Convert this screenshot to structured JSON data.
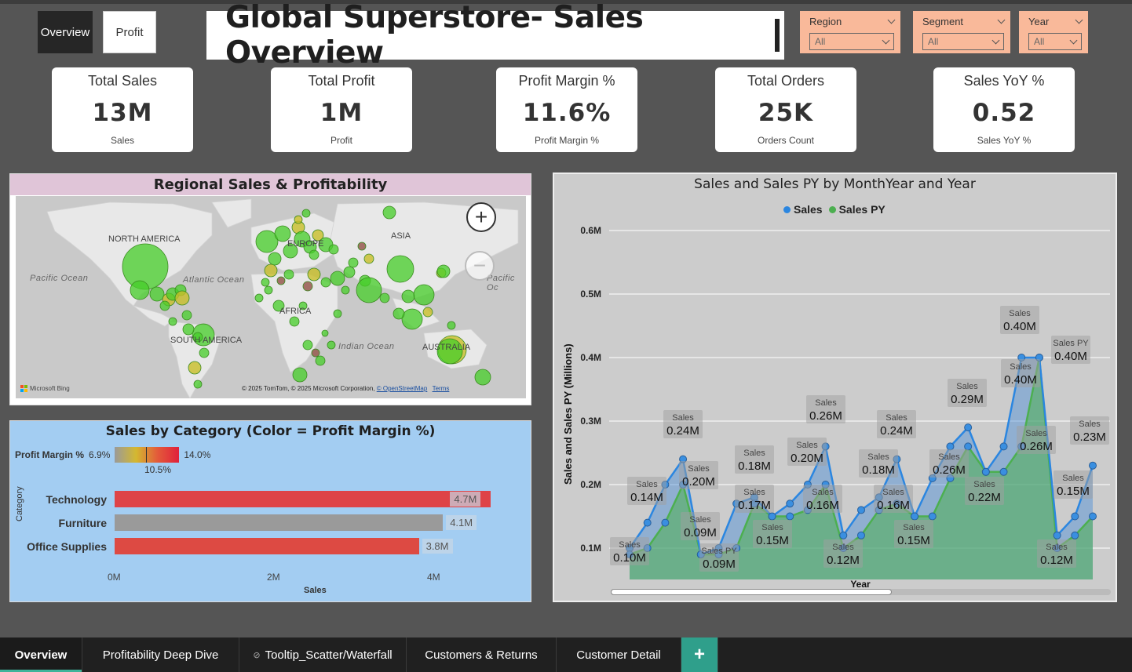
{
  "nav": {
    "overview_label": "Overview",
    "profit_label": "Profit"
  },
  "title": "Global Superstore- Sales Overview",
  "slicers": [
    {
      "label": "Region",
      "value": "All"
    },
    {
      "label": "Segment",
      "value": "All"
    },
    {
      "label": "Year",
      "value": "All"
    }
  ],
  "kpis": [
    {
      "title": "Total Sales",
      "value": "13M",
      "sub": "Sales"
    },
    {
      "title": "Total Profit",
      "value": "1M",
      "sub": "Profit"
    },
    {
      "title": "Profit Margin %",
      "value": "11.6%",
      "sub": "Profit Margin %"
    },
    {
      "title": "Total Orders",
      "value": "25K",
      "sub": "Orders Count"
    },
    {
      "title": "Sales YoY %",
      "value": "0.52",
      "sub": "Sales YoY %"
    }
  ],
  "map": {
    "title": "Regional Sales & Profitability",
    "labels": {
      "na": "NORTH AMERICA",
      "sa": "SOUTH AMERICA",
      "eu": "EUROPE",
      "asia": "ASIA",
      "africa": "AFRICA",
      "aus": "AUSTRALIA"
    },
    "oceans": {
      "pacific": "Pacific Ocean",
      "atlantic": "Atlantic Ocean",
      "indian": "Indian Ocean",
      "pacific2": "Pacific Oc"
    },
    "attribution": "© 2025 TomTom, © 2025 Microsoft Corporation,",
    "osm": "© OpenStreetMap",
    "terms": "Terms",
    "bing": "Microsoft Bing",
    "zoom_in": "+",
    "zoom_out": "−"
  },
  "category": {
    "title": "Sales by Category (Color = Profit Margin %)",
    "legend_label": "Profit Margin %",
    "legend_min": "6.9%",
    "legend_max": "14.0%",
    "legend_mid": "10.5%",
    "axis_title": "Category",
    "x_title": "Sales",
    "ticks": [
      "0M",
      "2M",
      "4M"
    ],
    "colors": {
      "technology": "#de4347",
      "furniture": "#9a9a9a",
      "office": "#dd4a43"
    }
  },
  "chart_data": [
    {
      "type": "bar",
      "title": "Sales by Category (Color = Profit Margin %)",
      "categories": [
        "Technology",
        "Furniture",
        "Office Supplies"
      ],
      "values": [
        4.7,
        4.1,
        3.8
      ],
      "value_labels": [
        "4.7M",
        "4.1M",
        "3.8M"
      ],
      "xlabel": "Sales",
      "ylabel": "Category",
      "xlim": [
        0,
        4.7
      ]
    },
    {
      "type": "area",
      "title": "Sales and Sales PY by MonthYear and Year",
      "xlabel": "Year",
      "ylabel": "Sales and Sales PY (Millions)",
      "ylim": [
        0.1,
        0.6
      ],
      "yticks": [
        "0.6M",
        "0.5M",
        "0.4M",
        "0.3M",
        "0.2M",
        "0.1M"
      ],
      "legend_position": "top",
      "series": [
        {
          "name": "Sales",
          "color": "#2b86e0",
          "values": [
            0.1,
            0.14,
            0.2,
            0.24,
            0.09,
            0.1,
            0.17,
            0.18,
            0.15,
            0.17,
            0.2,
            0.26,
            0.12,
            0.16,
            0.18,
            0.24,
            0.15,
            0.21,
            0.26,
            0.29,
            0.22,
            0.26,
            0.4,
            0.4,
            0.12,
            0.15,
            0.23
          ]
        },
        {
          "name": "Sales PY",
          "color": "#4caf50",
          "values": [
            0.09,
            0.1,
            0.14,
            0.2,
            0.09,
            0.09,
            0.1,
            0.17,
            0.15,
            0.15,
            0.16,
            0.2,
            0.1,
            0.12,
            0.16,
            0.17,
            0.15,
            0.15,
            0.21,
            0.26,
            0.22,
            0.22,
            0.26,
            0.4,
            0.1,
            0.12,
            0.15
          ]
        }
      ],
      "point_labels": [
        {
          "series": "Sales",
          "text": "0.10M"
        },
        {
          "series": "Sales",
          "text": "0.14M"
        },
        {
          "series": "Sales",
          "text": "0.24M"
        },
        {
          "series": "Sales",
          "text": "0.20M"
        },
        {
          "series": "Sales",
          "text": "0.09M"
        },
        {
          "series": "Sales PY",
          "text": "0.09M"
        },
        {
          "series": "Sales",
          "text": "0.18M"
        },
        {
          "series": "Sales",
          "text": "0.17M"
        },
        {
          "series": "Sales",
          "text": "0.15M"
        },
        {
          "series": "Sales",
          "text": "0.20M"
        },
        {
          "series": "Sales",
          "text": "0.26M"
        },
        {
          "series": "Sales",
          "text": "0.16M"
        },
        {
          "series": "Sales",
          "text": "0.12M"
        },
        {
          "series": "Sales",
          "text": "0.18M"
        },
        {
          "series": "Sales",
          "text": "0.24M"
        },
        {
          "series": "Sales",
          "text": "0.16M"
        },
        {
          "series": "Sales",
          "text": "0.15M"
        },
        {
          "series": "Sales",
          "text": "0.29M"
        },
        {
          "series": "Sales",
          "text": "0.26M"
        },
        {
          "series": "Sales",
          "text": "0.22M"
        },
        {
          "series": "Sales",
          "text": "0.40M"
        },
        {
          "series": "Sales",
          "text": "0.40M"
        },
        {
          "series": "Sales PY",
          "text": "0.40M"
        },
        {
          "series": "Sales",
          "text": "0.26M"
        },
        {
          "series": "Sales",
          "text": "0.23M"
        },
        {
          "series": "Sales",
          "text": "0.15M"
        },
        {
          "series": "Sales",
          "text": "0.12M"
        }
      ]
    }
  ],
  "line_legend": {
    "sales": "Sales",
    "sales_py": "Sales PY"
  },
  "tabs": [
    {
      "label": "Overview",
      "active": true
    },
    {
      "label": "Profitability Deep Dive"
    },
    {
      "label": "Tooltip_Scatter/Waterfall"
    },
    {
      "label": "Customers & Returns"
    },
    {
      "label": "Customer Detail"
    }
  ],
  "tab_add": "+"
}
